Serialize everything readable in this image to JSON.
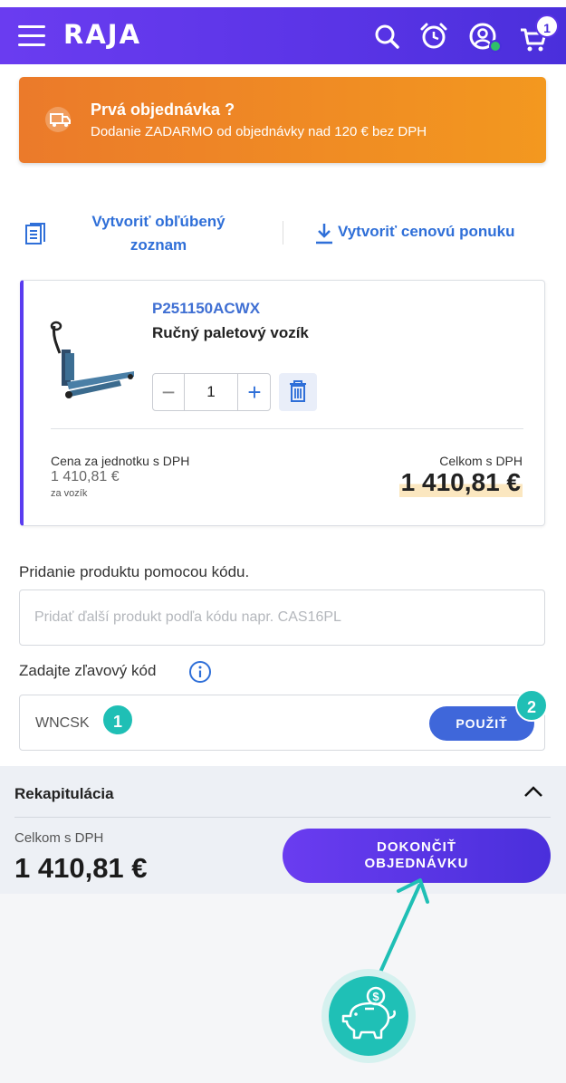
{
  "header": {
    "logo": "RAJA",
    "cart_count": "1"
  },
  "promo": {
    "title": "Prvá objednávka ?",
    "subtitle": "Dodanie ZADARMO od objednávky nad 120 € bez DPH"
  },
  "actions": {
    "favorite_list": "Vytvoriť obľúbený zoznam",
    "price_offer": "Vytvoriť cenovú ponuku"
  },
  "cart_item": {
    "code": "P251150ACWX",
    "name": "Ručný paletový vozík",
    "quantity": "1",
    "minus": "−",
    "plus": "+",
    "unit_price_label": "Cena za jednotku s DPH",
    "unit_price": "1 410,81 €",
    "unit": "za vozík",
    "total_label": "Celkom s DPH",
    "total": "1 410,81 €"
  },
  "add_by_code": {
    "label": "Pridanie produktu pomocou kódu.",
    "placeholder": "Pridať ďalší produkt podľa kódu napr. CAS16PL"
  },
  "discount": {
    "label": "Zadajte zľavový kód",
    "value": "WNCSK",
    "apply": "POUŽIŤ",
    "step_1": "1",
    "step_2": "2"
  },
  "recap": {
    "title": "Rekapitulácia",
    "total_label": "Celkom s DPH",
    "total": "1 410,81 €",
    "finish_line1": "DOKONČIŤ",
    "finish_line2": "OBJEDNÁVKU"
  },
  "colors": {
    "brand_purple": "#5a34e6",
    "promo_orange": "#f0891f",
    "link_blue": "#2f6fd8",
    "teal": "#1fbfb5"
  },
  "icons": [
    "menu-icon",
    "search-icon",
    "alarm-clock-icon",
    "user-icon",
    "cart-icon",
    "truck-icon",
    "list-icon",
    "download-icon",
    "trash-icon",
    "info-icon",
    "chevron-up-icon",
    "piggy-bank-icon"
  ]
}
